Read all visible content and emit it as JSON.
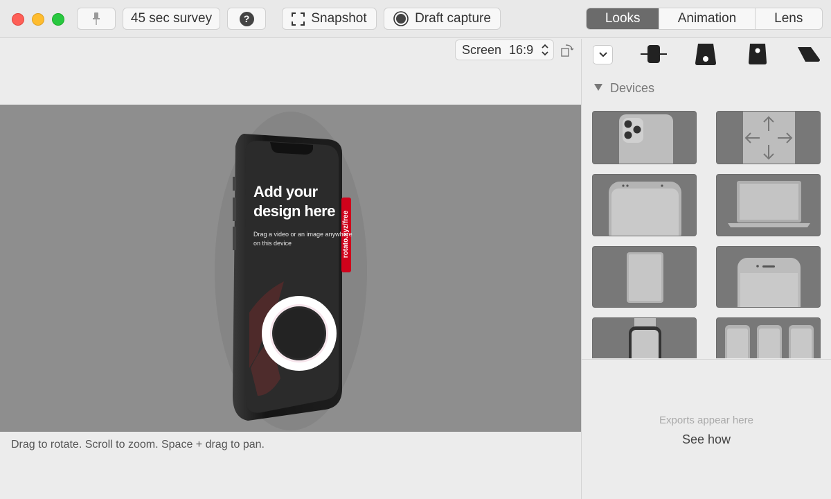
{
  "toolbar": {
    "survey_label": "45 sec survey",
    "help_label": "?",
    "snapshot_label": "Snapshot",
    "draft_label": "Draft capture",
    "tabs": [
      {
        "label": "Looks",
        "active": true
      },
      {
        "label": "Animation",
        "active": false
      },
      {
        "label": "Lens",
        "active": false
      }
    ]
  },
  "canvas": {
    "screen_label": "Screen",
    "aspect": "16:9",
    "hint": "Drag to rotate. Scroll to zoom. Space + drag to pan."
  },
  "device_screen": {
    "headline_1": "Add your",
    "headline_2": "design here",
    "sub_1": "Drag a video or an image anywhere",
    "sub_2": "on this device",
    "watermark": "rotato.xyz/free"
  },
  "panel": {
    "devices_label": "Devices",
    "device_tiles": [
      "phone-back",
      "move-arrows",
      "phone-front-top",
      "laptop",
      "tablet",
      "phone-classic",
      "watch",
      "phone-trio"
    ],
    "exports_message": "Exports appear here",
    "see_how_label": "See how"
  },
  "colors": {
    "stage": "#8e8e8e",
    "active_tab": "#6b6b6b",
    "watermark": "#d0021b"
  }
}
